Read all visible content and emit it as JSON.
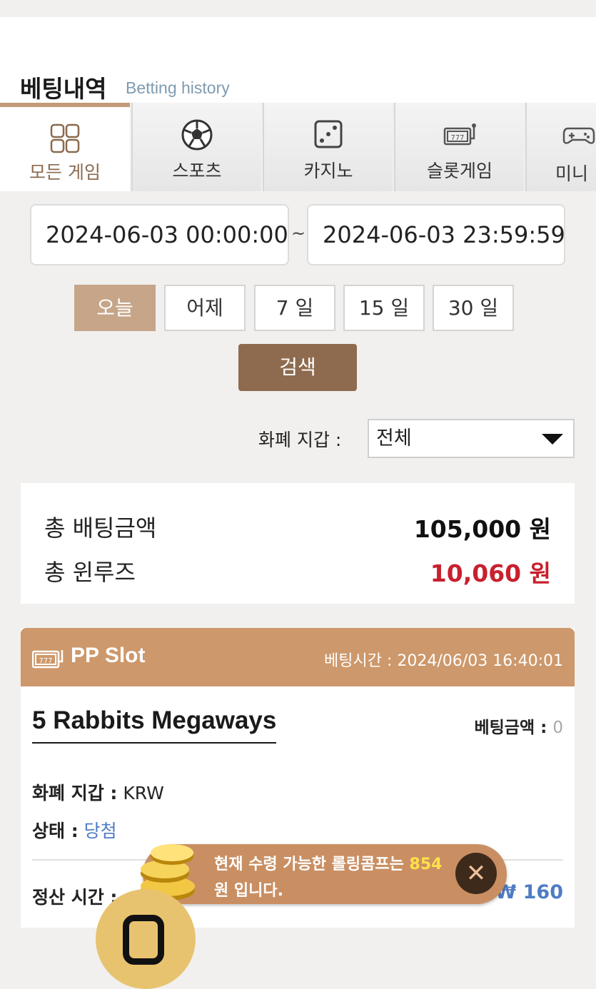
{
  "header": {
    "title": "베팅내역",
    "subtitle": "Betting history"
  },
  "tabs": [
    {
      "label": "모든 게임",
      "icon": "grid-icon"
    },
    {
      "label": "스포츠",
      "icon": "soccer-ball-icon"
    },
    {
      "label": "카지노",
      "icon": "dice-icon"
    },
    {
      "label": "슬롯게임",
      "icon": "slot-machine-icon"
    },
    {
      "label": "미니",
      "icon": "gamepad-icon"
    }
  ],
  "date_range": {
    "from": "2024-06-03 00:00:00",
    "to": "2024-06-03 23:59:59",
    "separator": "~"
  },
  "quick_ranges": [
    "오늘",
    "어제",
    "7 일",
    "15 일",
    "30 일"
  ],
  "search_label": "검색",
  "wallet_filter": {
    "label": "화폐 지갑 :",
    "value": "전체"
  },
  "summary": {
    "total_bet_label": "총 배팅금액",
    "total_bet_value": "105,000 원",
    "total_winloss_label": "총 윈루즈",
    "total_winloss_value": "10,060 원"
  },
  "bet_card": {
    "provider": "PP Slot",
    "bet_time": "베팅시간 : 2024/06/03 16:40:01",
    "game_name": "5 Rabbits Megaways",
    "bet_amount_label": "베팅금액 :",
    "bet_amount_value": "0",
    "wallet_label": "화폐 지갑 :",
    "wallet_value": "KRW",
    "status_label": "상태 :",
    "status_value": "당첨",
    "settle_label": "정산 시간 :",
    "win_amount": "₩ 160"
  },
  "toast": {
    "line1_prefix": "현재 수령 가능한 롤링콤프는",
    "line1_number": "854",
    "line2": "원 입니다."
  },
  "colors": {
    "accent": "#c29a77",
    "search_button": "#8e6b4f",
    "card_header": "#cd986b",
    "loss_red": "#c8202e",
    "link_blue": "#4f7cc4"
  }
}
